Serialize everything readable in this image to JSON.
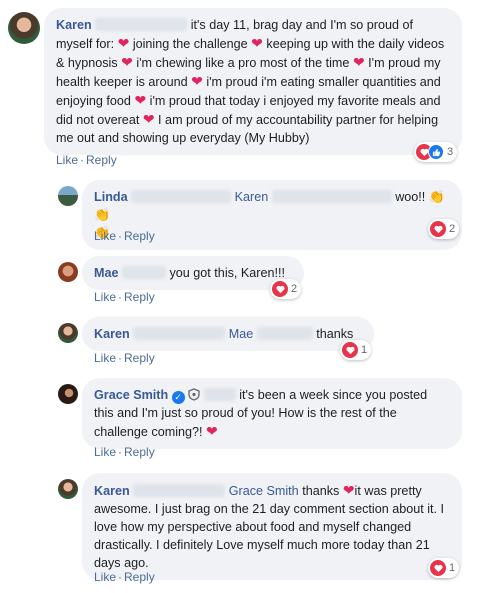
{
  "comments": [
    {
      "author": "Karen",
      "text_parts": {
        "a": " it's day 11, brag day and I'm so proud of myself for: ",
        "b": " joining the challenge ",
        "c": " keeping up with the daily videos & hypnosis ",
        "d": " i'm chewing like a pro most of the time ",
        "e": " I'm proud my health keeper is around ",
        "f": " i'm proud i'm eating smaller quantities and enjoying food ",
        "g": " i'm proud that today i enjoyed my favorite meals and did not overeat ",
        "h": " I am proud of my accountability partner for helping me out and showing up everyday (My Hubby)"
      },
      "like": "Like",
      "reply": "Reply",
      "react_count": "3"
    },
    {
      "author": "Linda",
      "mention": "Karen",
      "text": "woo!! ",
      "like": "Like",
      "reply": "Reply",
      "react_count": "2"
    },
    {
      "author": "Mae",
      "text": "you got this, Karen!!!",
      "like": "Like",
      "reply": "Reply",
      "react_count": "2"
    },
    {
      "author": "Karen",
      "mention": "Mae",
      "text": "thanks",
      "like": "Like",
      "reply": "Reply",
      "react_count": "1"
    },
    {
      "author": "Grace Smith",
      "text": " it's been a week since you posted this and I'm just so proud of you! How is the rest of the challenge coming?! ",
      "like": "Like",
      "reply": "Reply"
    },
    {
      "author": "Karen",
      "mention": "Grace Smith",
      "text_a": " thanks ",
      "text_b": "it was pretty awesome. I just brag on the 21 day comment section about it. I love how my perspective about food and myself changed drastically. I definitely Love myself much more today than 21 days ago.",
      "like": "Like",
      "reply": "Reply",
      "react_count": "1"
    }
  ],
  "colors": {
    "link": "#385898",
    "bubble": "#f0f2f5",
    "heart": "#e0245e",
    "like": "#1877f2"
  },
  "icons": {
    "heart": "heart-icon",
    "clap": "clapping-hands-icon",
    "verified": "verified-badge-icon",
    "shield": "shield-icon"
  }
}
